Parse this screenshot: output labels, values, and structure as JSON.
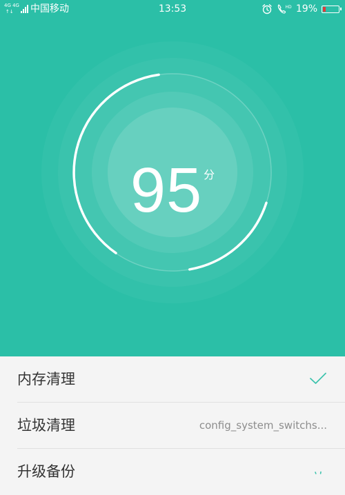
{
  "status_bar": {
    "network_label_top": "4G 4G",
    "carrier": "中国移动",
    "time": "13:53",
    "battery": "19%",
    "battery_level_percent": 19,
    "icons": [
      "signal-icon",
      "alarm-icon",
      "hd-call-icon",
      "battery-icon"
    ]
  },
  "score": {
    "value": "95",
    "unit": "分"
  },
  "items": [
    {
      "label": "内存清理",
      "status": "done",
      "icon": "check-icon"
    },
    {
      "label": "垃圾清理",
      "value": "config_system_switchs..."
    },
    {
      "label": "升级备份",
      "status": "loading",
      "icon": "loading-spinner-icon"
    }
  ],
  "colors": {
    "primary": "#2bbfa7",
    "list_background": "#f4f4f4",
    "check": "#3ec3ad",
    "battery_low": "#e23b3b"
  }
}
